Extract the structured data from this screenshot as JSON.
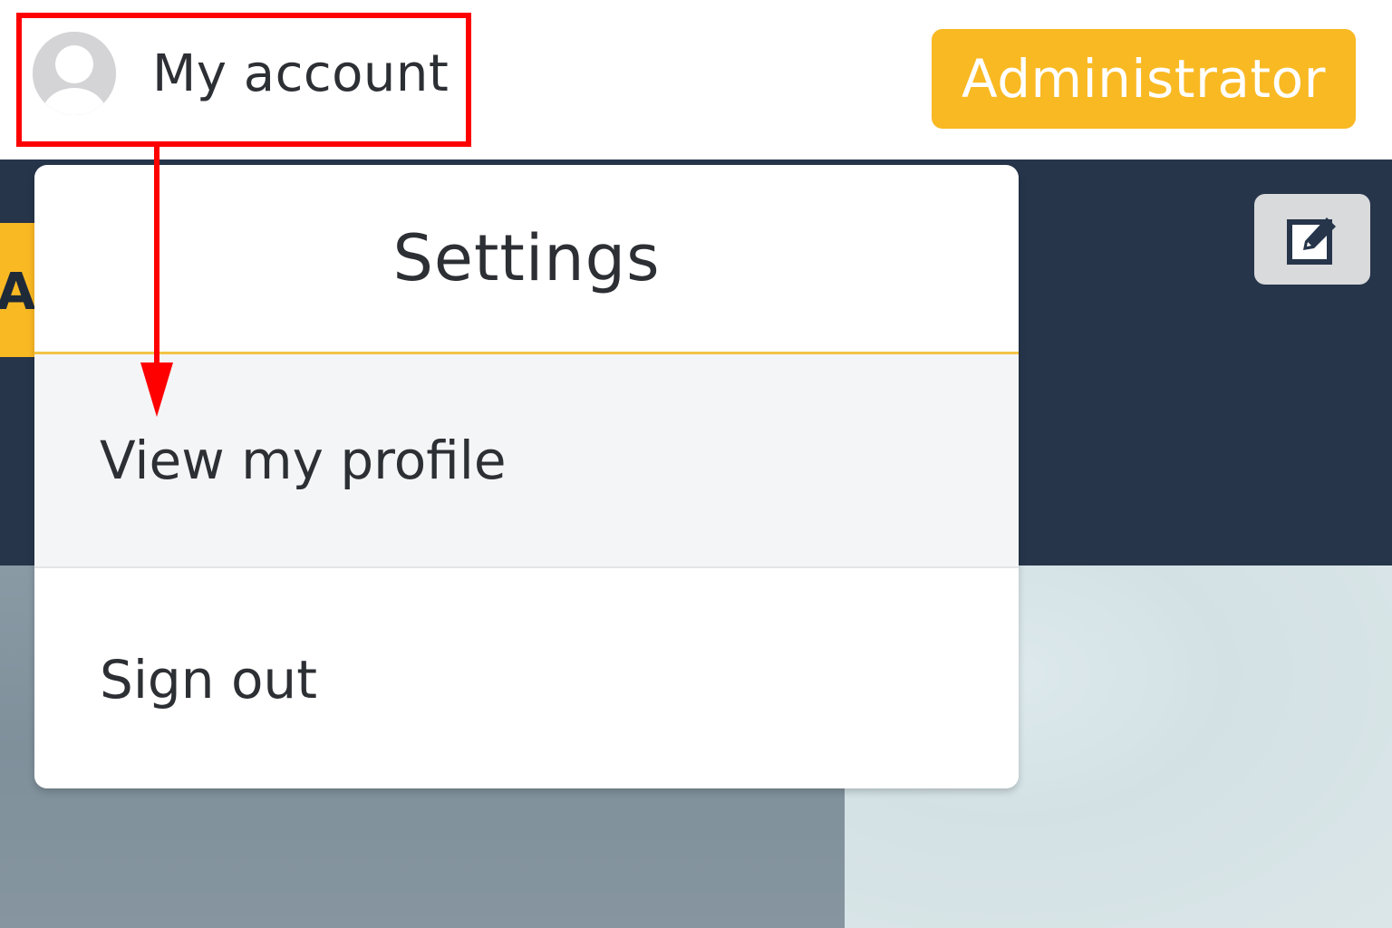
{
  "header": {
    "account_label": "My account",
    "avatar_icon": "user-avatar-icon",
    "role_badge": "Administrator",
    "badge_color": "#f9b923"
  },
  "background": {
    "band_color": "#26354a",
    "side_tab_text": "A",
    "edit_icon": "edit-icon"
  },
  "dropdown": {
    "title": "Settings",
    "accent_color": "#f3c445",
    "items": [
      {
        "label": "View my profile",
        "highlighted": true
      },
      {
        "label": "Sign out",
        "highlighted": false
      }
    ]
  },
  "annotation": {
    "color": "#ff0000"
  }
}
